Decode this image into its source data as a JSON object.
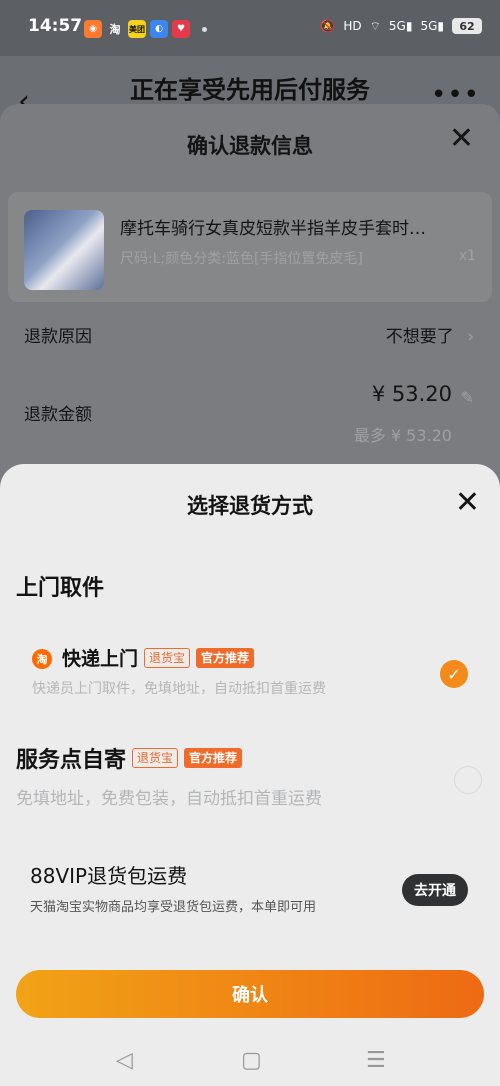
{
  "status_bar": {
    "time": "14:57",
    "apps": [
      "淘",
      "美团"
    ],
    "network": "HD",
    "signal1": "5G",
    "signal2": "5G",
    "battery": "62"
  },
  "page": {
    "title": "正在享受先用后付服务"
  },
  "refund_sheet": {
    "title": "确认退款信息",
    "product": {
      "name": "摩托车骑行女真皮短款半指羊皮手套时…",
      "spec": "尺码:L;颜色分类:蓝色[手指位置免皮毛]",
      "qty": "x1"
    },
    "reason_label": "退款原因",
    "reason_value": "不想要了",
    "amount_label": "退款金额",
    "amount_value": "¥ 53.20",
    "amount_max": "最多 ¥ 53.20"
  },
  "return_sheet": {
    "title": "选择退货方式",
    "section_title": "上门取件",
    "option1": {
      "icon_text": "淘",
      "title": "快递上门",
      "tag1": "退货宝",
      "tag2": "官方推荐",
      "desc": "快递员上门取件，免填地址，自动抵扣首重运费",
      "selected": true
    },
    "option2": {
      "title": "服务点自寄",
      "tag1": "退货宝",
      "tag2": "官方推荐",
      "desc": "免填地址，免费包装，自动抵扣首重运费",
      "selected": false
    },
    "vip": {
      "title": "88VIP退货包运费",
      "desc": "天猫淘宝实物商品均享受退货包运费，本单即可用",
      "button": "去开通"
    },
    "confirm_button": "确认"
  },
  "colors": {
    "accent": "#f06a2a",
    "confirm_start": "#f1a316",
    "confirm_end": "#ee6a13"
  },
  "nav_icons": [
    "back-icon",
    "home-icon",
    "menu-icon"
  ]
}
